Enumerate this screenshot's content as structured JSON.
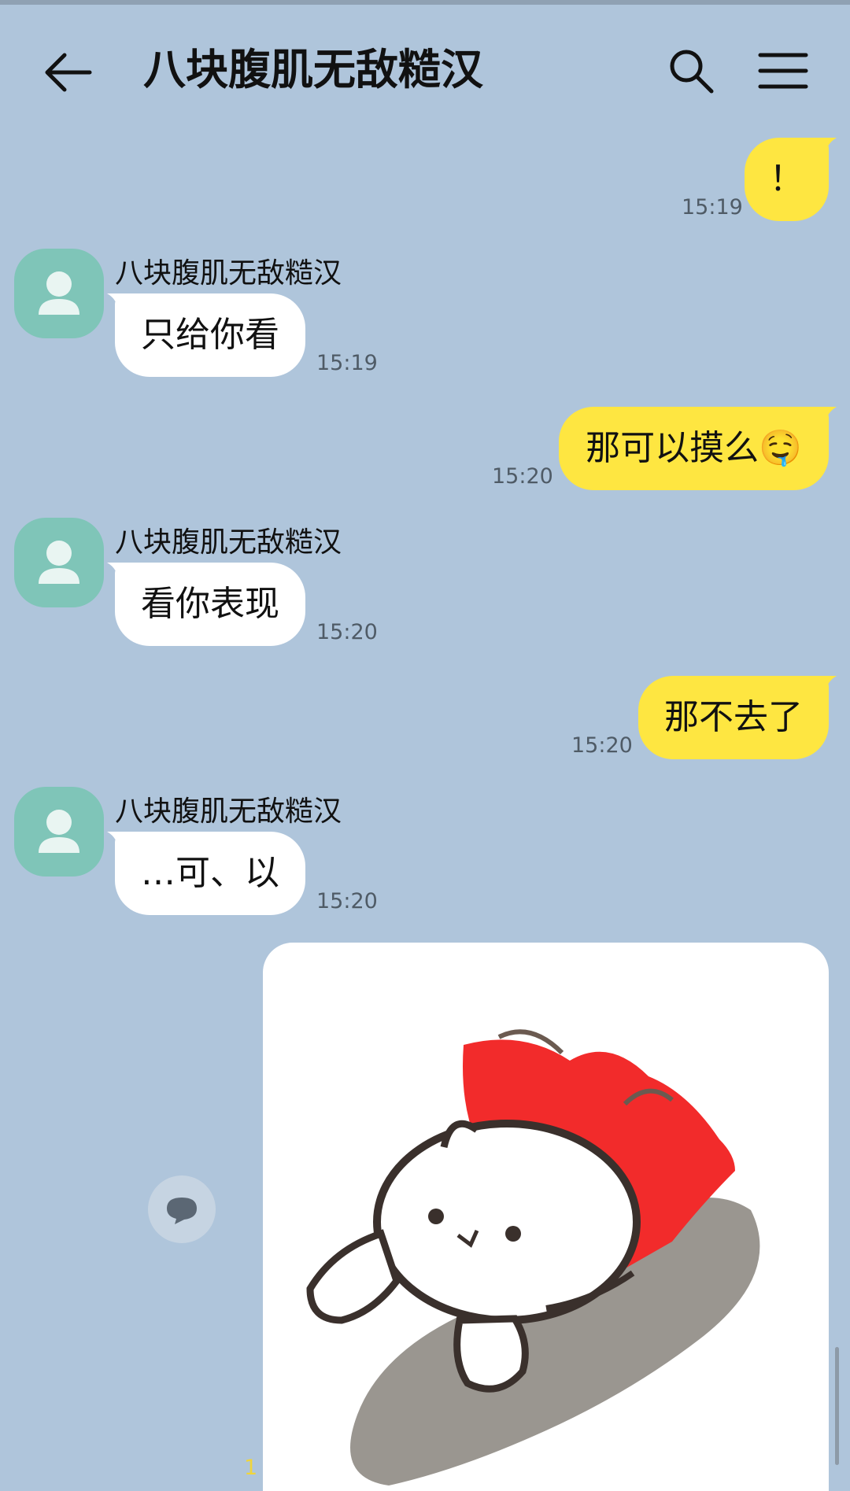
{
  "header": {
    "title": "八块腹肌无敌糙汉",
    "back_icon": "arrow-left-icon",
    "search_icon": "search-icon",
    "menu_icon": "menu-icon"
  },
  "colors": {
    "background": "#afc5db",
    "sent_bubble": "#fee641",
    "received_bubble": "#ffffff",
    "avatar": "#7fc5b8",
    "unread_count": "#f0d53a"
  },
  "messages": [
    {
      "direction": "sent",
      "text": "！",
      "time": "15:19"
    },
    {
      "direction": "received",
      "sender": "八块腹肌无敌糙汉",
      "text": "只给你看",
      "time": "15:19"
    },
    {
      "direction": "sent",
      "text": "那可以摸么🤤",
      "time": "15:20"
    },
    {
      "direction": "received",
      "sender": "八块腹肌无敌糙汉",
      "text": "看你表现",
      "time": "15:20"
    },
    {
      "direction": "sent",
      "text": "那不去了",
      "time": "15:20"
    },
    {
      "direction": "received",
      "sender": "八块腹肌无敌糙汉",
      "text": "…可、以",
      "time": "15:20"
    },
    {
      "direction": "sent",
      "type": "sticker",
      "sticker": "cat-with-red-cape-flying",
      "unread_count": "1"
    }
  ],
  "reply_icon": "speech-bubble-icon"
}
